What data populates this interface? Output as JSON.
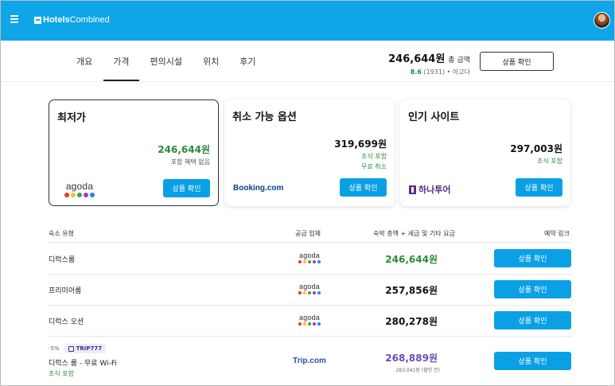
{
  "header": {
    "brand_bold": "Hotels",
    "brand_thin": "Combined"
  },
  "tabs": [
    {
      "label": "개요"
    },
    {
      "label": "가격"
    },
    {
      "label": "편의시설"
    },
    {
      "label": "위치"
    },
    {
      "label": "후기"
    }
  ],
  "summary": {
    "price": "246,644원",
    "label": "총 금액",
    "score": "8.6",
    "count": "(1931)",
    "rating_label": "• 아고다",
    "button": "상품 확인"
  },
  "cards": [
    {
      "title": "최저가",
      "price": "246,644원",
      "note1": "포함 혜택 없음",
      "note2": "",
      "provider": "agoda",
      "button": "상품 확인"
    },
    {
      "title": "취소 가능 옵션",
      "price": "319,699원",
      "note1": "조식 포함",
      "note2": "무료 취소",
      "provider": "Booking.com",
      "button": "상품 확인"
    },
    {
      "title": "인기 사이트",
      "price": "297,003원",
      "note1": "조식 포함",
      "note2": "",
      "provider": "하나투어",
      "button": "상품 확인"
    }
  ],
  "table": {
    "headers": [
      "숙소 유형",
      "공급 업체",
      "숙박 총액 + 세금 및 기타 요금",
      "예약 링크"
    ],
    "rows": [
      {
        "name": "디럭스룸",
        "provider": "agoda",
        "price": "246,644원",
        "button": "상품 확인"
      },
      {
        "name": "프리미어룸",
        "provider": "agoda",
        "price": "257,856원",
        "button": "상품 확인"
      },
      {
        "name": "디럭스 오션",
        "provider": "agoda",
        "price": "280,278원",
        "button": "상품 확인"
      },
      {
        "name": "디럭스 룸 - 무료 Wi-Fi",
        "provider": "Trip.com",
        "price": "268,889원",
        "discount": "-5%",
        "coupon": "TRIP777",
        "sub": "조식 포함",
        "sub_price": "283,041원 (할인 전)",
        "button": "상품 확인"
      }
    ]
  },
  "colors": {
    "brand_blue": "#0ea5e9",
    "button_blue": "#0aa0e6",
    "price_green": "#2a8a3b",
    "price_purple": "#6d4bb5"
  }
}
